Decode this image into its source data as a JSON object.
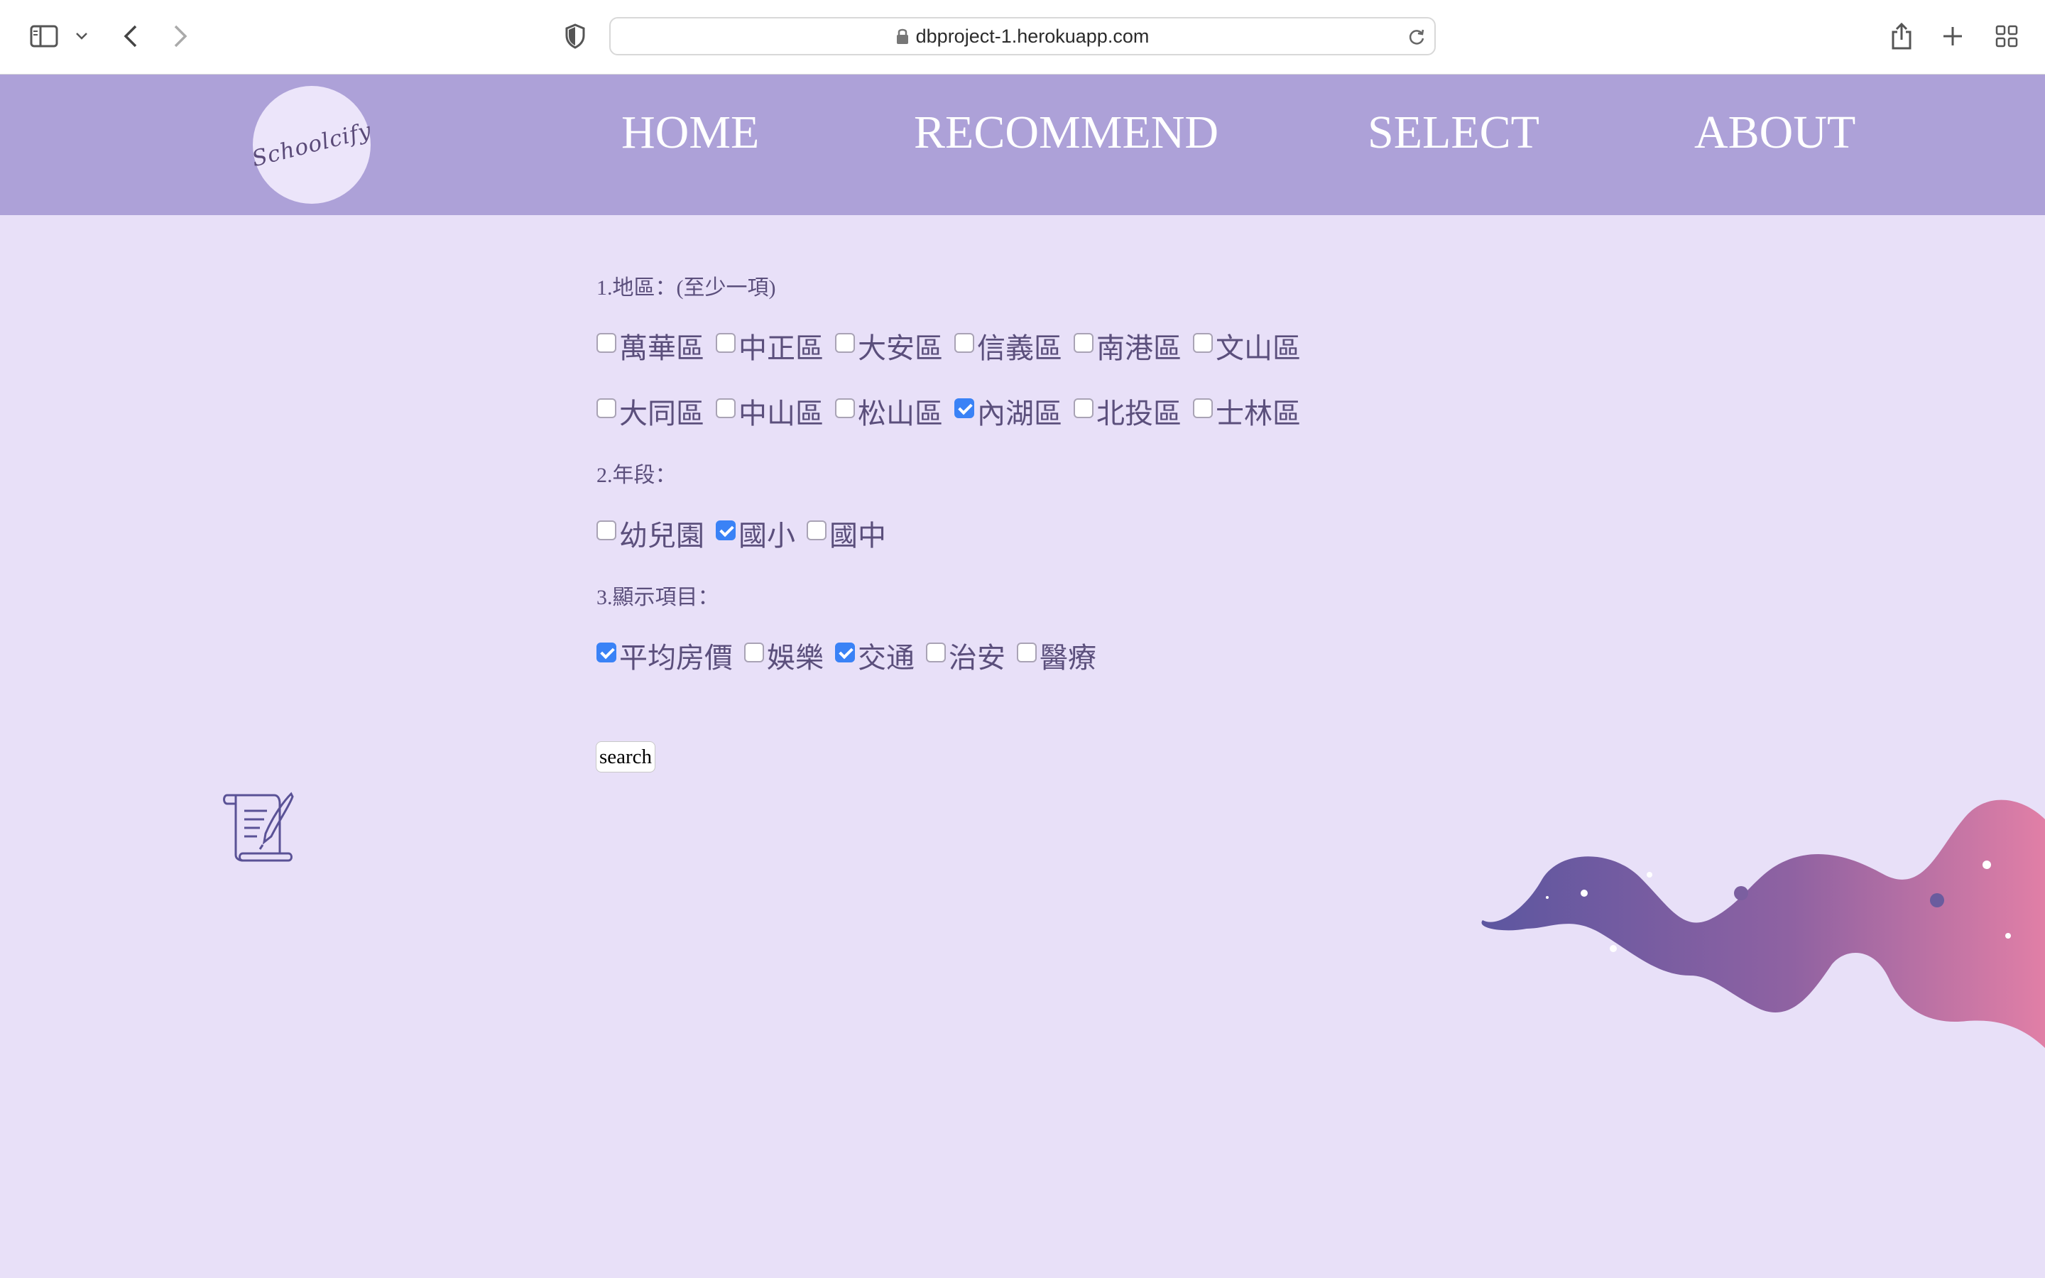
{
  "browser": {
    "url": "dbproject-1.herokuapp.com"
  },
  "header": {
    "logo_text": "Schoolcify",
    "nav": [
      {
        "label": "HOME"
      },
      {
        "label": "RECOMMEND"
      },
      {
        "label": "SELECT"
      },
      {
        "label": "ABOUT"
      }
    ]
  },
  "form": {
    "district": {
      "label": "1.地區：(至少一項)",
      "rows": [
        [
          {
            "label": "萬華區",
            "checked": false
          },
          {
            "label": "中正區",
            "checked": false
          },
          {
            "label": "大安區",
            "checked": false
          },
          {
            "label": "信義區",
            "checked": false
          },
          {
            "label": "南港區",
            "checked": false
          },
          {
            "label": "文山區",
            "checked": false
          }
        ],
        [
          {
            "label": "大同區",
            "checked": false
          },
          {
            "label": "中山區",
            "checked": false
          },
          {
            "label": "松山區",
            "checked": false
          },
          {
            "label": "內湖區",
            "checked": true
          },
          {
            "label": "北投區",
            "checked": false
          },
          {
            "label": "士林區",
            "checked": false
          }
        ]
      ]
    },
    "level": {
      "label": "2.年段：",
      "options": [
        {
          "label": "幼兒園",
          "checked": false
        },
        {
          "label": "國小",
          "checked": true
        },
        {
          "label": "國中",
          "checked": false
        }
      ]
    },
    "display": {
      "label": "3.顯示項目：",
      "options": [
        {
          "label": "平均房價",
          "checked": true
        },
        {
          "label": "娛樂",
          "checked": false
        },
        {
          "label": "交通",
          "checked": true
        },
        {
          "label": "治安",
          "checked": false
        },
        {
          "label": "醫療",
          "checked": false
        }
      ]
    },
    "search_label": "search"
  },
  "colors": {
    "header_bg": "#ada1d8",
    "page_bg": "#e8e0f8",
    "text": "#5b4f7c",
    "checkbox_checked": "#3a82f6"
  },
  "icons": [
    "sidebar-icon",
    "chevron-down-icon",
    "back-icon",
    "forward-icon",
    "shield-icon",
    "lock-icon",
    "reload-icon",
    "share-icon",
    "plus-icon",
    "tabs-grid-icon",
    "scroll-icon"
  ]
}
